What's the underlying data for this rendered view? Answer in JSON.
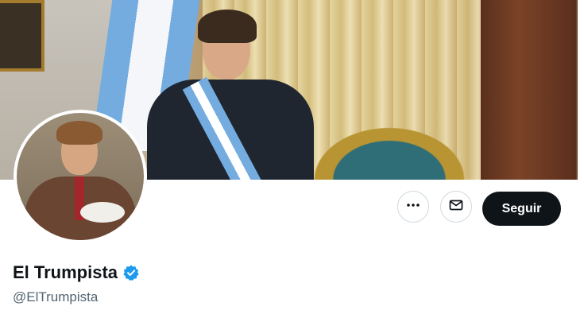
{
  "profile": {
    "display_name": "El Trumpista",
    "handle": "@ElTrumpista",
    "verified": true
  },
  "actions": {
    "more_icon": "more-horizontal-icon",
    "message_icon": "envelope-icon",
    "follow_label": "Seguir"
  },
  "colors": {
    "follow_button_bg": "#0f1419",
    "verified_badge": "#1d9bf0",
    "handle_text": "#536471"
  }
}
